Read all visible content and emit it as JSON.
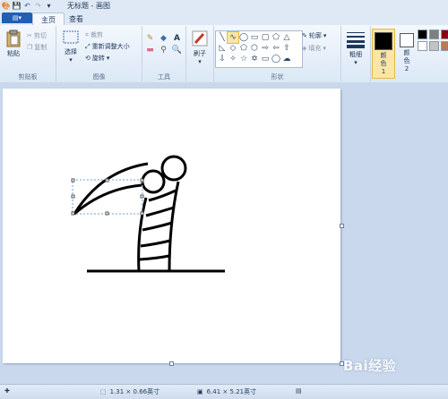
{
  "window": {
    "title": "无标题 - 画图"
  },
  "file_menu": {
    "label": "▤▾"
  },
  "tabs": [
    {
      "label": "主页",
      "active": true
    },
    {
      "label": "查看",
      "active": false
    }
  ],
  "clipboard": {
    "paste": "粘贴",
    "cut": "剪切",
    "copy": "复制",
    "group": "剪贴板"
  },
  "image": {
    "select": "选择",
    "crop": "裁剪",
    "resize": "重新调整大小",
    "rotate": "旋转",
    "group": "图像"
  },
  "tools": {
    "group": "工具"
  },
  "brushes": {
    "label": "刷子"
  },
  "shapes": {
    "outline": "轮廓",
    "fill": "填充",
    "group": "形状"
  },
  "size": {
    "label": "粗细"
  },
  "colors": {
    "color1": "颜色 1",
    "color2": "颜色 2",
    "color1_value": "#000000",
    "color2_value": "#ffffff",
    "palette": [
      "#000000",
      "#7f7f7f",
      "#880015",
      "#ffffff",
      "#c3c3c3",
      "#b97a57"
    ]
  },
  "status": {
    "selection_size": "1.31 × 0.66英寸",
    "image_size": "6.41 × 5.21英寸"
  },
  "watermark": {
    "text": "Bai经验"
  }
}
